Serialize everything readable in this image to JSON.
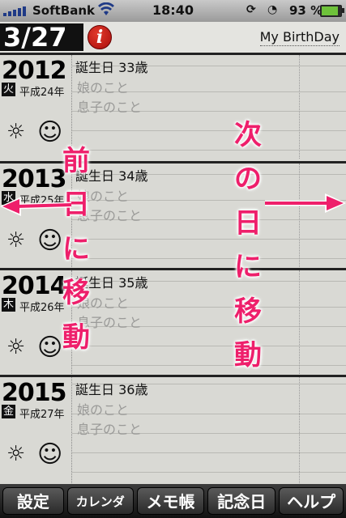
{
  "status_bar": {
    "carrier": "SoftBank",
    "time": "18:40",
    "battery": "93 %",
    "battery_level": 0.93
  },
  "header": {
    "date": "3/27",
    "info_icon": "i",
    "title": "My BirthDay"
  },
  "rows": [
    {
      "year": "2012",
      "weekday": "火",
      "era": "平成24年",
      "line1": "誕生日 33歳",
      "line2": "娘のこと",
      "line3": "息子のこと"
    },
    {
      "year": "2013",
      "weekday": "水",
      "era": "平成25年",
      "line1": "誕生日 34歳",
      "line2": "娘のこと",
      "line3": "息子のこと"
    },
    {
      "year": "2014",
      "weekday": "木",
      "era": "平成26年",
      "line1": "誕生日 35歳",
      "line2": "娘のこと",
      "line3": "息子のこと"
    },
    {
      "year": "2015",
      "weekday": "金",
      "era": "平成27年",
      "line1": "誕生日 36歳",
      "line2": "娘のこと",
      "line3": "息子のこと"
    }
  ],
  "icons": {
    "sun": "☼",
    "smile": "☺"
  },
  "overlay": {
    "left": [
      "前",
      "日",
      "に",
      "移",
      "動"
    ],
    "right": [
      "次",
      "の",
      "日",
      "に",
      "移",
      "動"
    ],
    "color": "#ee1f6b"
  },
  "toolbar": {
    "settings": "設定",
    "calendar": "カレンダ",
    "memo": "メモ帳",
    "anniversary": "記念日",
    "help": "ヘルプ"
  }
}
